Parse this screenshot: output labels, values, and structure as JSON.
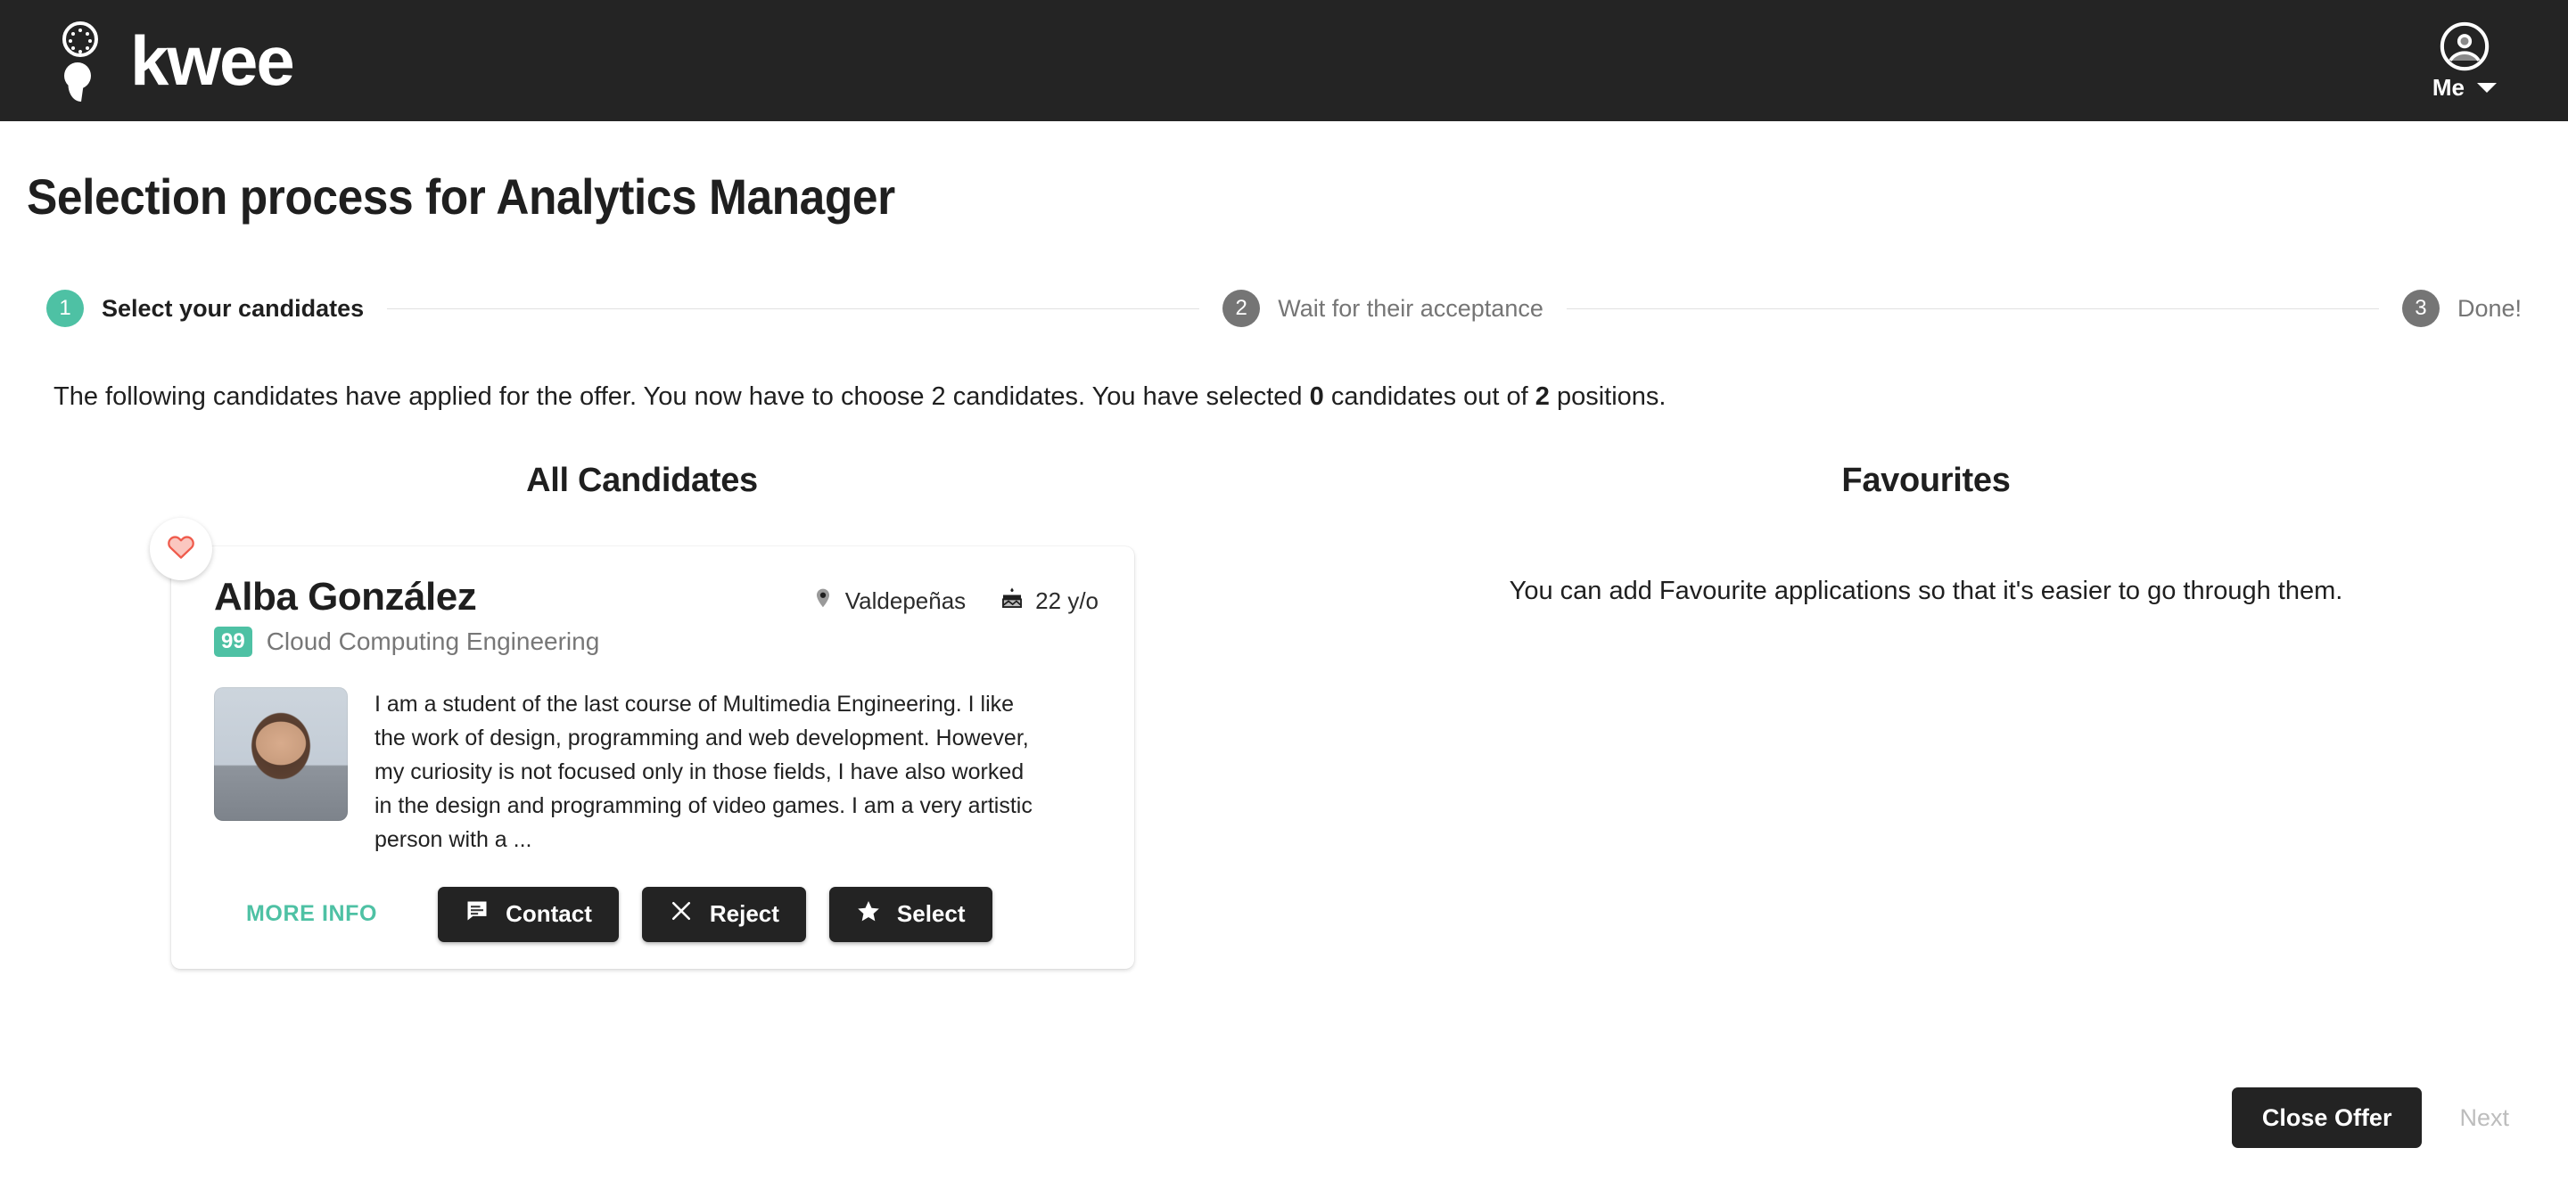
{
  "topbar": {
    "brand_name": "kwee",
    "logo_icon": "kwee-semicolon-logo",
    "account_label": "Me",
    "account_icon": "account-circle-icon",
    "caret_icon": "chevron-down-icon"
  },
  "page": {
    "title": "Selection process for Analytics Manager"
  },
  "stepper": {
    "steps": [
      {
        "number": "1",
        "label": "Select your candidates",
        "state": "active"
      },
      {
        "number": "2",
        "label": "Wait for their acceptance",
        "state": "inactive"
      },
      {
        "number": "3",
        "label": "Done!",
        "state": "inactive"
      }
    ],
    "active_color": "#4ec1a4",
    "inactive_color": "#757575"
  },
  "intro": {
    "part1": "The following candidates have applied for the offer. You now have to choose 2 candidates. You have selected ",
    "selected_count": "0",
    "part2": " candidates out of ",
    "positions": "2",
    "part3": " positions."
  },
  "columns": {
    "all_candidates_title": "All Candidates",
    "favourites_title": "Favourites",
    "favourites_empty": "You can add Favourite applications so that it's easier to go through them."
  },
  "candidate": {
    "favourite_icon": "heart-icon",
    "favourite_color": "#ef5b4c",
    "name": "Alba González",
    "score": "99",
    "score_color": "#4ec1a4",
    "role": "Cloud Computing Engineering",
    "location_icon": "location-pin-icon",
    "location": "Valdepeñas",
    "age_icon": "birthday-cake-icon",
    "age": "22 y/o",
    "photo_icon": "candidate-photo",
    "bio": "I am a student of the last course of Multimedia Engineering. I like the work of design, programming and web development. However, my curiosity is not focused only in those fields, I have also worked in the design and programming of video games. I am a very artistic person with a ...",
    "actions": {
      "more_info": "MORE INFO",
      "contact": "Contact",
      "contact_icon": "message-icon",
      "reject": "Reject",
      "reject_icon": "close-x-icon",
      "select": "Select",
      "select_icon": "star-icon"
    }
  },
  "footer": {
    "close_offer": "Close Offer",
    "next": "Next"
  }
}
